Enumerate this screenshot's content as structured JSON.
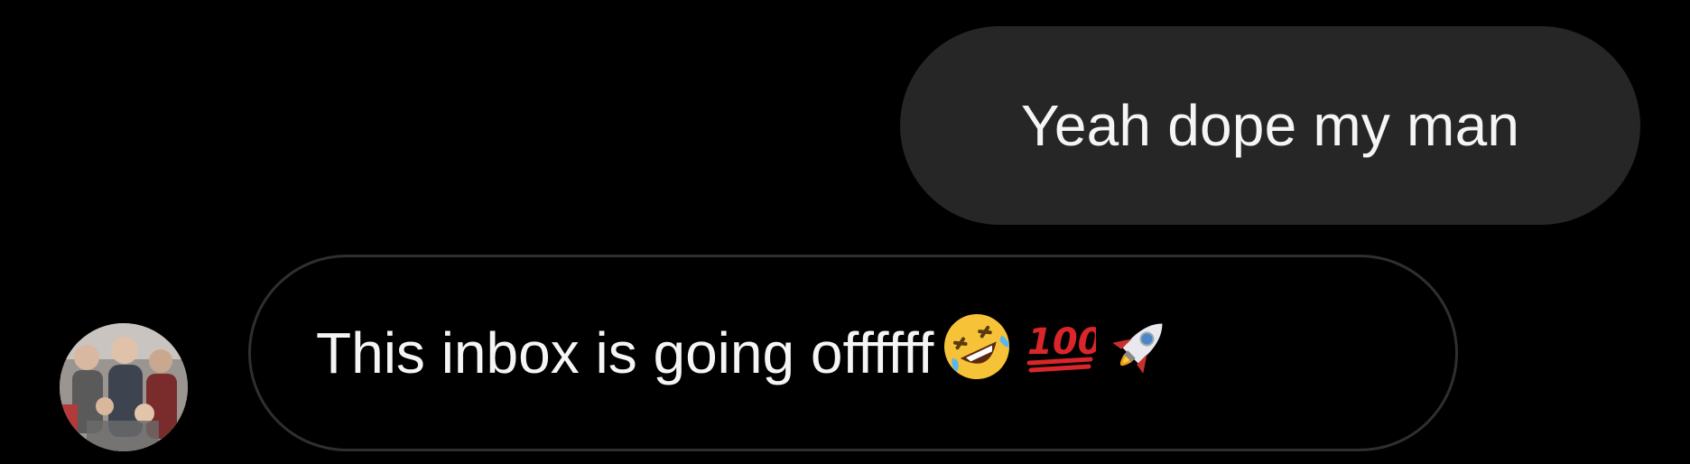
{
  "conversation": {
    "sent_message": {
      "text": "Yeah dope my man"
    },
    "received_message": {
      "text": "This inbox is going offffff",
      "emojis": [
        "rolling-on-floor-laughing-emoji",
        "hundred-points-emoji",
        "rocket-emoji"
      ]
    },
    "sender_avatar": {
      "icon": "user-avatar-photo"
    }
  },
  "colors": {
    "background": "#000000",
    "sent_bubble": "#262626",
    "received_bubble_border": "#2f2f2f",
    "text": "#f5f5f5"
  }
}
